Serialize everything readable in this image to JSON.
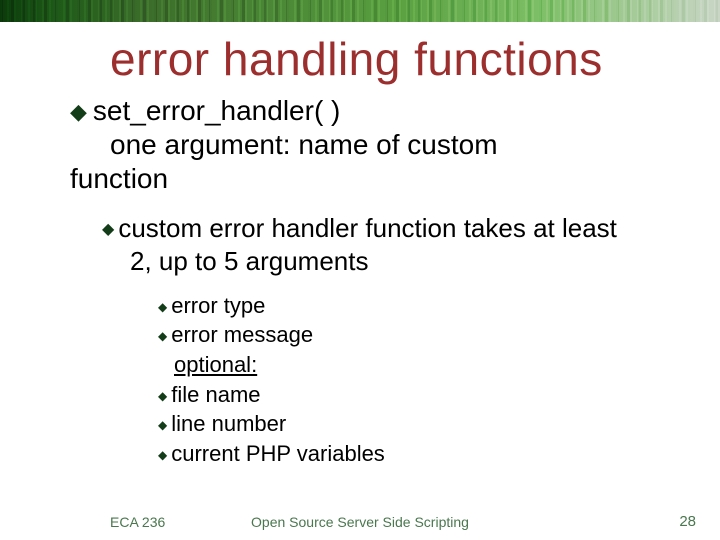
{
  "title": "error handling functions",
  "bullet1": {
    "func": "set_error_handler( )",
    "desc_line": "one argument: name of custom",
    "desc_cont": "function"
  },
  "bullet2": {
    "line1": "custom error handler function takes at least",
    "line2": "2, up to 5 arguments"
  },
  "args": {
    "a": "error type",
    "b": "error message",
    "opt": "optional:",
    "c": "file name",
    "d": "line number",
    "e": "current PHP variables"
  },
  "footer": {
    "left": "ECA 236",
    "center": "Open Source Server Side Scripting",
    "right": "28"
  }
}
